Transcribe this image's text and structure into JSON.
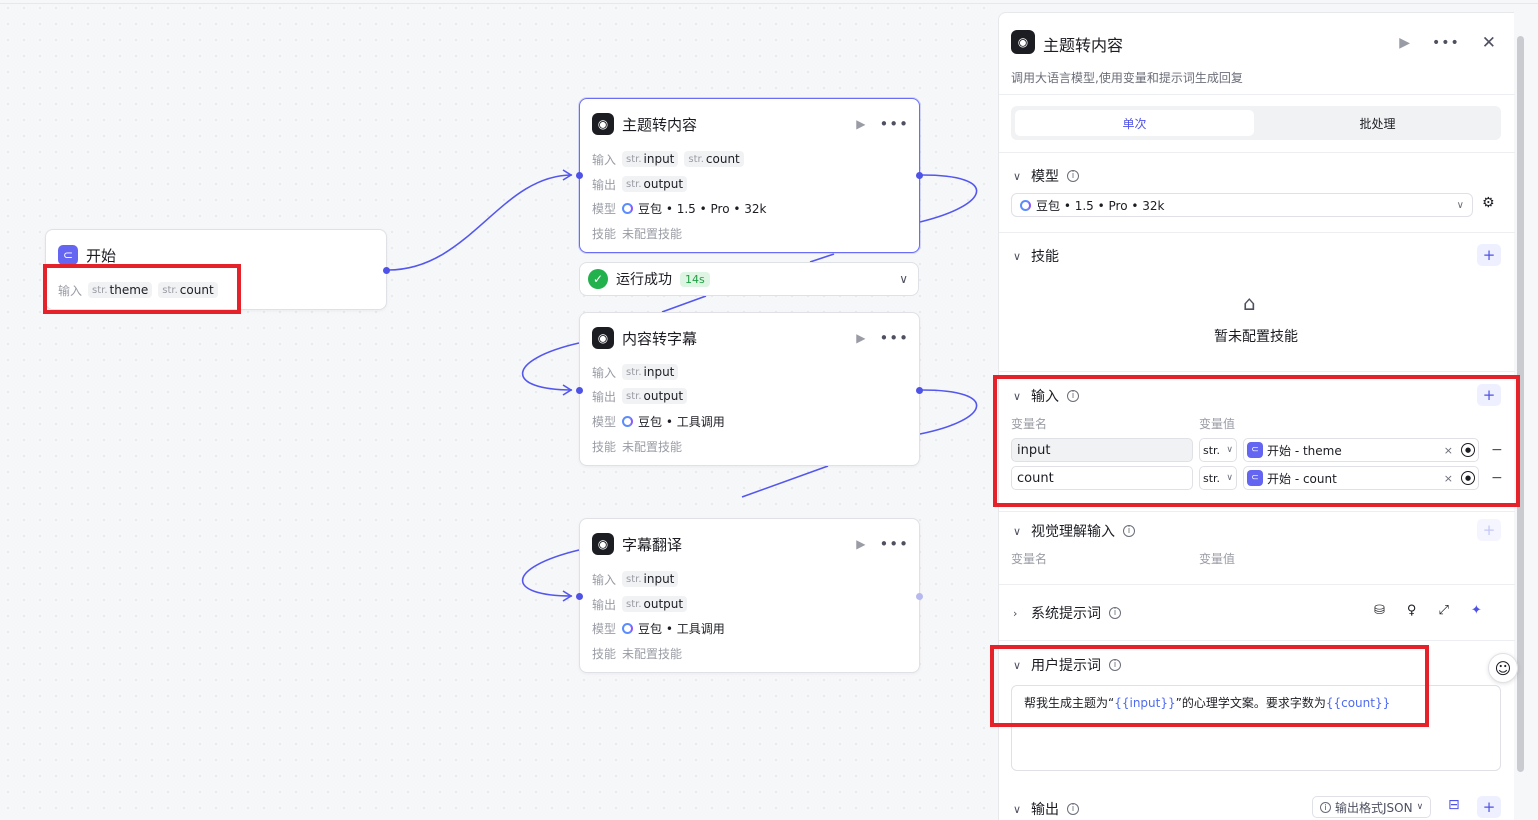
{
  "canvas": {
    "start_node": {
      "title": "开始",
      "input_label": "输入",
      "inputs": [
        {
          "type": "str.",
          "name": "theme"
        },
        {
          "type": "str.",
          "name": "count"
        }
      ]
    },
    "nodes": [
      {
        "title": "主题转内容",
        "input_label": "输入",
        "inputs": [
          {
            "type": "str.",
            "name": "input"
          },
          {
            "type": "str.",
            "name": "count"
          }
        ],
        "output_label": "输出",
        "outputs": [
          {
            "type": "str.",
            "name": "output"
          }
        ],
        "model_label": "模型",
        "model": "豆包 • 1.5 • Pro • 32k",
        "skill_label": "技能",
        "skill": "未配置技能"
      },
      {
        "title": "内容转字幕",
        "input_label": "输入",
        "inputs": [
          {
            "type": "str.",
            "name": "input"
          }
        ],
        "output_label": "输出",
        "outputs": [
          {
            "type": "str.",
            "name": "output"
          }
        ],
        "model_label": "模型",
        "model": "豆包 • 工具调用",
        "skill_label": "技能",
        "skill": "未配置技能"
      },
      {
        "title": "字幕翻译",
        "input_label": "输入",
        "inputs": [
          {
            "type": "str.",
            "name": "input"
          }
        ],
        "output_label": "输出",
        "outputs": [
          {
            "type": "str.",
            "name": "output"
          }
        ],
        "model_label": "模型",
        "model": "豆包 • 工具调用",
        "skill_label": "技能",
        "skill": "未配置技能"
      }
    ],
    "status": {
      "text": "运行成功",
      "time": "14s"
    }
  },
  "panel": {
    "title": "主题转内容",
    "description": "调用大语言模型,使用变量和提示词生成回复",
    "tabs": {
      "single": "单次",
      "batch": "批处理"
    },
    "model_section": {
      "title": "模型",
      "selected": "豆包 • 1.5 • Pro • 32k"
    },
    "skill_section": {
      "title": "技能",
      "empty": "暂未配置技能"
    },
    "input_section": {
      "title": "输入",
      "col_name": "变量名",
      "col_value": "变量值",
      "rows": [
        {
          "name": "input",
          "type": "str.",
          "source": "开始 - theme"
        },
        {
          "name": "count",
          "type": "str.",
          "source": "开始 - count"
        }
      ]
    },
    "vision_section": {
      "title": "视觉理解输入",
      "col_name": "变量名",
      "col_value": "变量值"
    },
    "system_prompt": {
      "title": "系统提示词"
    },
    "user_prompt": {
      "title": "用户提示词",
      "part1": "帮我生成主题为“",
      "var1": "{{input}}",
      "part2": "”的心理学文案。要求字数为",
      "var2": "{{count}}"
    },
    "output_section": {
      "title": "输出",
      "format": "输出格式JSON"
    }
  },
  "colors": {
    "accent": "#4f52e6",
    "success": "#22b14c",
    "highlight": "#e5212a"
  }
}
